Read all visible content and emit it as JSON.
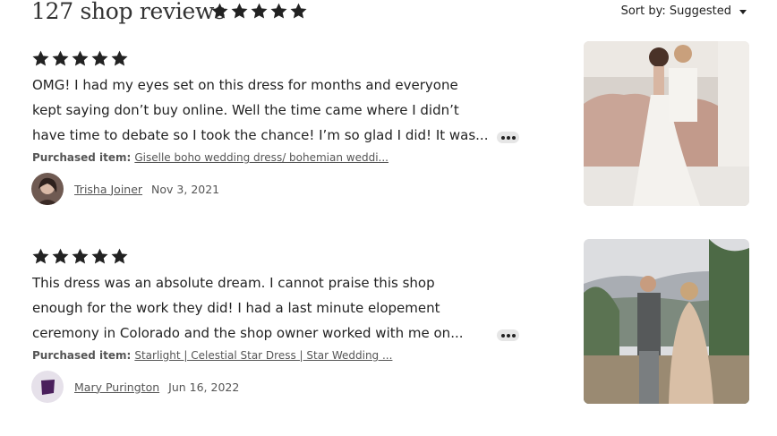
{
  "header": {
    "title": "127 shop reviews",
    "rating_stars": 5,
    "sort_label": "Sort by: Suggested"
  },
  "reviews": [
    {
      "stars": 5,
      "text_lines": [
        "OMG! I had my eyes set on this dress for months and everyone",
        "kept saying don’t buy online. Well the time came where I didn’t",
        "have time to debate so I took the chance! I’m so glad I did! It was..."
      ],
      "purchased_label": "Purchased item:",
      "purchased_item": "Giselle boho wedding dress/ bohemian weddi...",
      "author": "Trisha Joiner",
      "date": "Nov 3, 2021"
    },
    {
      "stars": 5,
      "text_lines": [
        "This dress was an absolute dream. I cannot praise this shop",
        "enough for the work they did! I had a last minute elopement",
        "ceremony in Colorado and the shop owner worked with me on..."
      ],
      "purchased_label": "Purchased item:",
      "purchased_item": "Starlight | Celestial Star Dress | Star Wedding ...",
      "author": "Mary Purington",
      "date": "Jun 16, 2022"
    }
  ],
  "colors": {
    "star": "#222222",
    "more_button": "#e6e6e6",
    "avatar2_bg": "#e6e1ea",
    "avatar2_icon": "#4a1f5c"
  },
  "icons": {
    "star": "star-icon",
    "sort": "chevron-down-icon",
    "more": "more-options-icon"
  }
}
